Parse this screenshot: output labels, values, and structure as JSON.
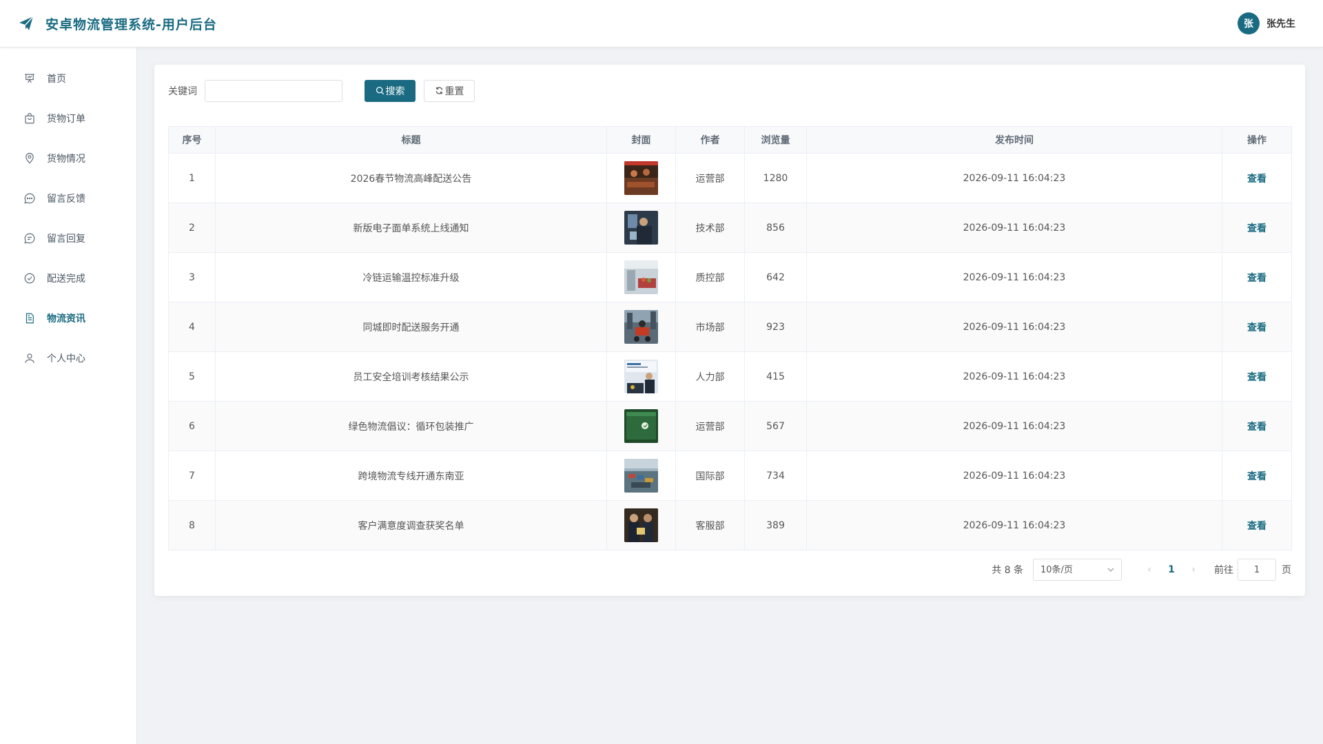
{
  "app": {
    "title": "安卓物流管理系统-用户后台",
    "brand_color": "#1a6b82",
    "logo_icon": "paper-plane-icon"
  },
  "user": {
    "avatar_initial": "张",
    "name": "张先生"
  },
  "sidebar": {
    "items": [
      {
        "label": "首页",
        "icon": "presentation-icon",
        "active": false
      },
      {
        "label": "货物订单",
        "icon": "shopping-bag-icon",
        "active": false
      },
      {
        "label": "货物情况",
        "icon": "map-pin-icon",
        "active": false
      },
      {
        "label": "留言反馈",
        "icon": "chat-bubble-icon",
        "active": false
      },
      {
        "label": "留言回复",
        "icon": "chat-reply-icon",
        "active": false
      },
      {
        "label": "配送完成",
        "icon": "check-circle-icon",
        "active": false
      },
      {
        "label": "物流资讯",
        "icon": "document-icon",
        "active": true
      },
      {
        "label": "个人中心",
        "icon": "user-icon",
        "active": false
      }
    ]
  },
  "search": {
    "label": "关键词",
    "value": "",
    "placeholder": "",
    "search_button": "搜索",
    "reset_button": "重置"
  },
  "table": {
    "columns": [
      "序号",
      "标题",
      "封面",
      "作者",
      "浏览量",
      "发布时间",
      "操作"
    ],
    "rows": [
      {
        "index": "1",
        "title": "2026春节物流高峰配送公告",
        "cover": "warehouse-workers-photo",
        "author": "运营部",
        "views": "1280",
        "time": "2026-09-11 16:04:23",
        "action": "查看"
      },
      {
        "index": "2",
        "title": "新版电子面单系统上线通知",
        "cover": "scanner-operator-photo",
        "author": "技术部",
        "views": "856",
        "time": "2026-09-11 16:04:23",
        "action": "查看"
      },
      {
        "index": "3",
        "title": "冷链运输温控标准升级",
        "cover": "cold-chain-truck-photo",
        "author": "质控部",
        "views": "642",
        "time": "2026-09-11 16:04:23",
        "action": "查看"
      },
      {
        "index": "4",
        "title": "同城即时配送服务开通",
        "cover": "courier-scooter-photo",
        "author": "市场部",
        "views": "923",
        "time": "2026-09-11 16:04:23",
        "action": "查看"
      },
      {
        "index": "5",
        "title": "员工安全培训考核结果公示",
        "cover": "safety-training-photo",
        "author": "人力部",
        "views": "415",
        "time": "2026-09-11 16:04:23",
        "action": "查看"
      },
      {
        "index": "6",
        "title": "绿色物流倡议：循环包装推广",
        "cover": "recycle-bins-photo",
        "author": "运营部",
        "views": "567",
        "time": "2026-09-11 16:04:23",
        "action": "查看"
      },
      {
        "index": "7",
        "title": "跨境物流专线开通东南亚",
        "cover": "container-port-photo",
        "author": "国际部",
        "views": "734",
        "time": "2026-09-11 16:04:23",
        "action": "查看"
      },
      {
        "index": "8",
        "title": "客户满意度调查获奖名单",
        "cover": "award-ceremony-photo",
        "author": "客服部",
        "views": "389",
        "time": "2026-09-11 16:04:23",
        "action": "查看"
      }
    ]
  },
  "pagination": {
    "total": "共 8 条",
    "page_size": "10条/页",
    "current_page": "1",
    "goto_label": "前往",
    "goto_value": "1",
    "unit": "页"
  }
}
